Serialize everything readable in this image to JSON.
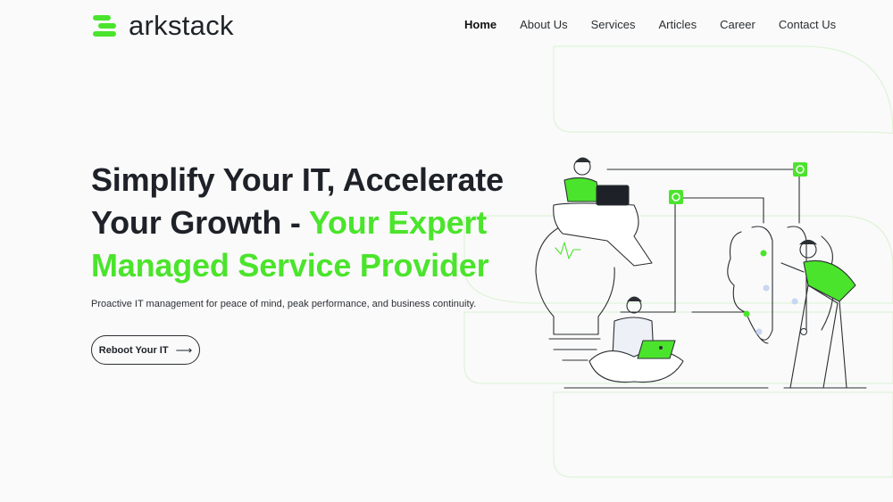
{
  "brand": {
    "name": "arkstack",
    "accent": "#4be42c"
  },
  "nav": {
    "items": [
      {
        "label": "Home",
        "active": true
      },
      {
        "label": "About Us"
      },
      {
        "label": "Services"
      },
      {
        "label": "Articles"
      },
      {
        "label": "Career"
      },
      {
        "label": "Contact Us"
      }
    ]
  },
  "hero": {
    "title_part1": "Simplify Your IT, Accelerate Your Growth - ",
    "title_accent": "Your Expert Managed Service Provider",
    "subtitle": "Proactive IT management for peace of mind, peak performance, and business continuity.",
    "cta_label": "Reboot Your IT",
    "cta_icon": "arrow-right-icon"
  },
  "colors": {
    "text": "#1e2228",
    "accent": "#4be42c",
    "background": "#fafafa"
  }
}
